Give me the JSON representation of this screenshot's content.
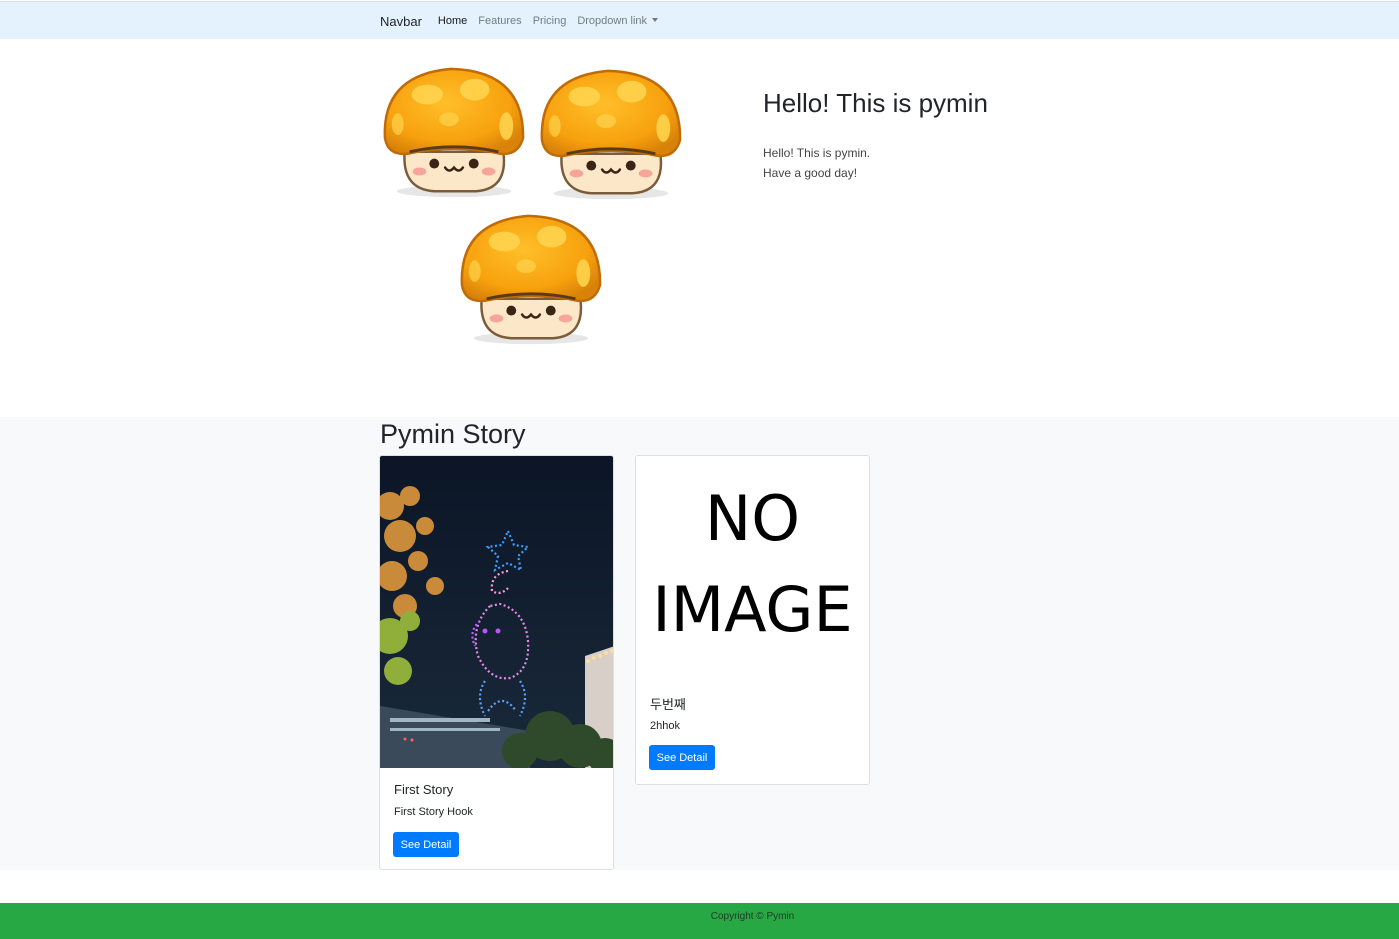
{
  "navbar": {
    "brand": "Navbar",
    "links": [
      {
        "label": "Home",
        "active": true
      },
      {
        "label": "Features",
        "active": false
      },
      {
        "label": "Pricing",
        "active": false
      },
      {
        "label": "Dropdown link",
        "active": false
      }
    ]
  },
  "hero": {
    "title": "Hello! This is pymin",
    "text_line1": "Hello! This is pymin.",
    "text_line2": "Have a good day!",
    "images": [
      "orange-mushroom-icon",
      "orange-mushroom-icon",
      "orange-mushroom-icon"
    ]
  },
  "story": {
    "title": "Pymin Story",
    "cards": [
      {
        "title": "First Story",
        "hook": "First Story Hook",
        "button": "See Detail",
        "image": "night-drone-show-photo"
      },
      {
        "title": "두번째",
        "hook": "2hhok",
        "button": "See Detail",
        "image_line1": "NO",
        "image_line2": "IMAGE"
      }
    ]
  },
  "footer": {
    "text": "Copyright © Pymin"
  },
  "colors": {
    "navbar_bg": "#e3f2fd",
    "primary": "#007bff",
    "footer_bg": "#28a745",
    "section_bg": "#f8f9fa"
  }
}
